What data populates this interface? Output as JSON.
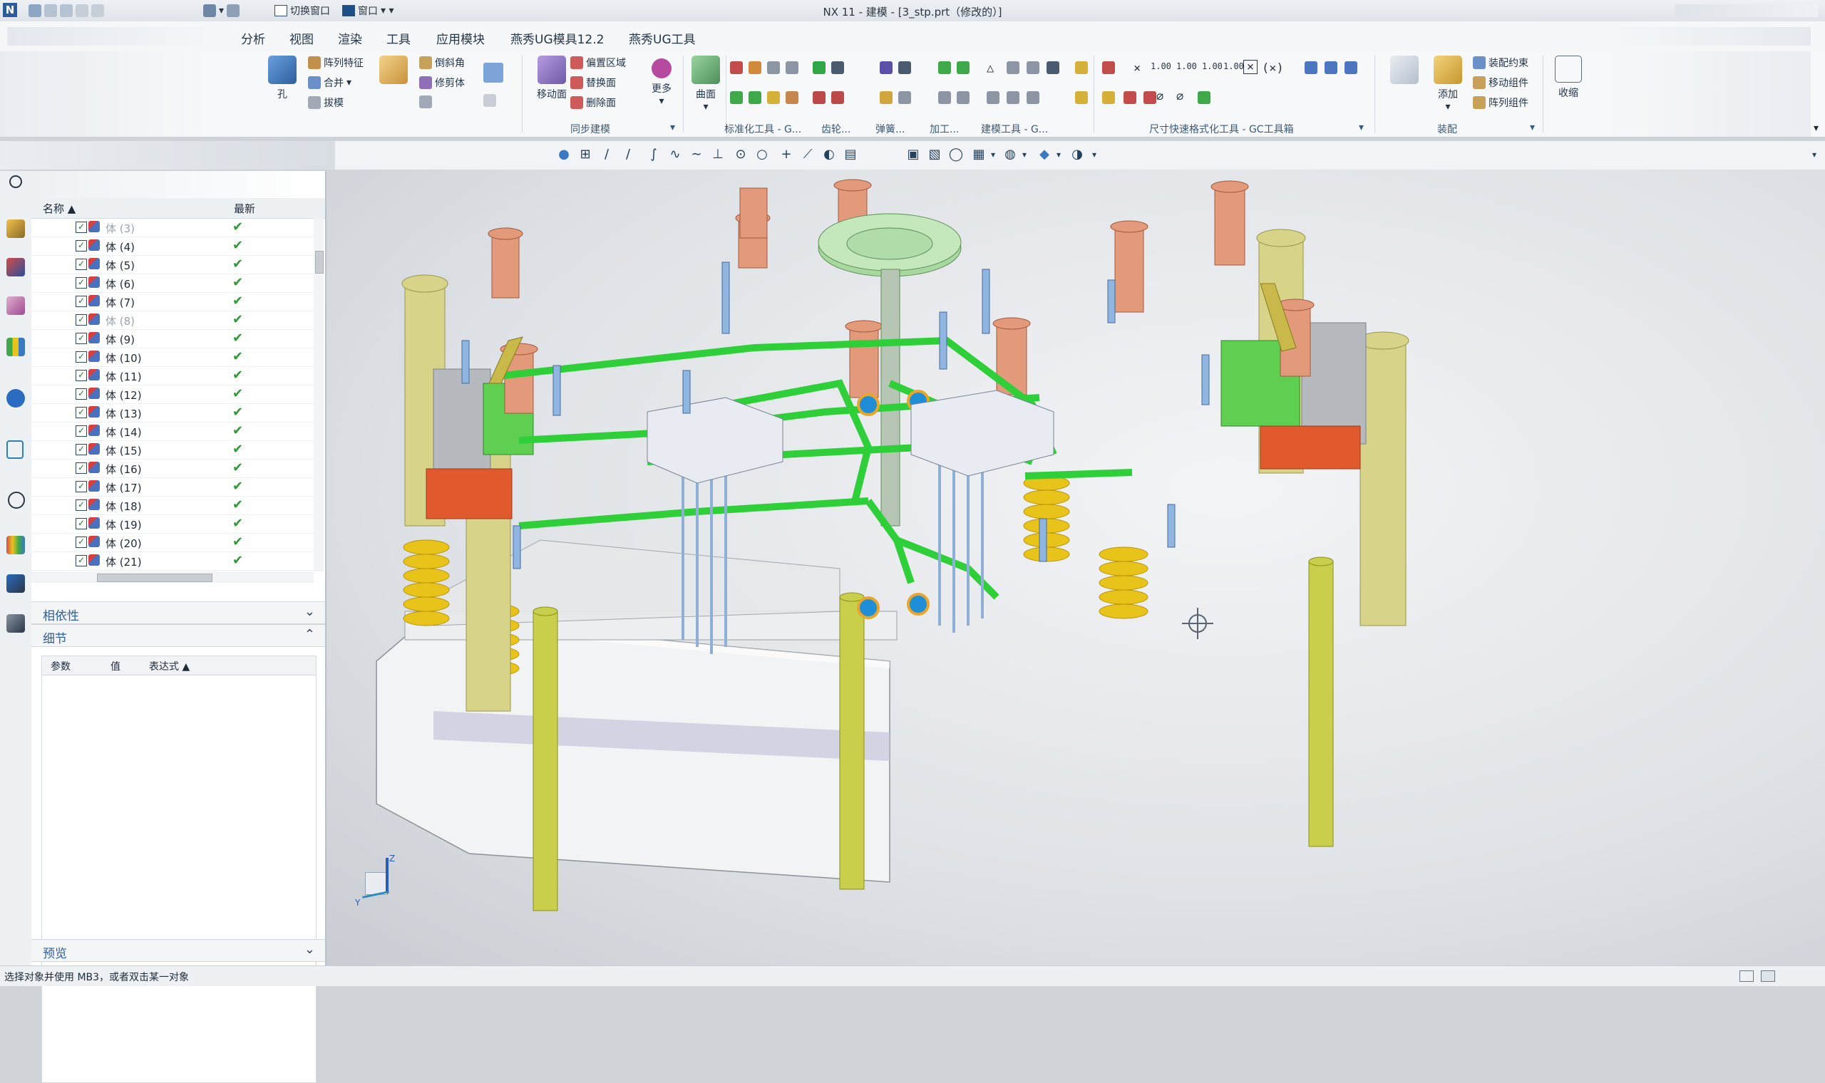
{
  "window": {
    "title": "NX 11 - 建模 - [3_stp.prt（修改的）]"
  },
  "quick_access": {
    "switch_window": "切换窗口",
    "window": "窗口"
  },
  "menu": [
    "分析",
    "视图",
    "渲染",
    "工具",
    "应用模块",
    "燕秀UG模具12.2",
    "燕秀UG工具"
  ],
  "ribbon": {
    "hole": "孔",
    "pattern_feature": "阵列特征",
    "unite": "合并",
    "draft": "拔模",
    "chamfer": "倒斜角",
    "trim_body": "修剪体",
    "move_face": "移动面",
    "offset_region": "偏置区域",
    "replace_face": "替换面",
    "delete_face": "删除面",
    "more": "更多",
    "sync_group": "同步建模",
    "surface": "曲面",
    "std_tools_group": "标准化工具 - G...",
    "gear_group": "齿轮...",
    "spring_group": "弹簧...",
    "machining_group": "加工...",
    "build_tools_group": "建模工具 - G...",
    "dim_group": "尺寸快速格式化工具 - GC工具箱",
    "assembly_constraints": "装配约束",
    "move_component": "移动组件",
    "pattern_component": "阵列组件",
    "add": "添加",
    "assembly_nav": "装配导航",
    "assembly_group": "装配",
    "shrink": "收缩"
  },
  "navigator": {
    "col_name": "名称",
    "col_latest": "最新",
    "rows": [
      {
        "label": "体 (3)",
        "dim": true
      },
      {
        "label": "体 (4)",
        "dim": false
      },
      {
        "label": "体 (5)",
        "dim": false
      },
      {
        "label": "体 (6)",
        "dim": false
      },
      {
        "label": "体 (7)",
        "dim": false
      },
      {
        "label": "体 (8)",
        "dim": true
      },
      {
        "label": "体 (9)",
        "dim": false
      },
      {
        "label": "体 (10)",
        "dim": false
      },
      {
        "label": "体 (11)",
        "dim": false
      },
      {
        "label": "体 (12)",
        "dim": false
      },
      {
        "label": "体 (13)",
        "dim": false
      },
      {
        "label": "体 (14)",
        "dim": false
      },
      {
        "label": "体 (15)",
        "dim": false
      },
      {
        "label": "体 (16)",
        "dim": false
      },
      {
        "label": "体 (17)",
        "dim": false
      },
      {
        "label": "体 (18)",
        "dim": false
      },
      {
        "label": "体 (19)",
        "dim": false
      },
      {
        "label": "体 (20)",
        "dim": false
      },
      {
        "label": "体 (21)",
        "dim": false
      }
    ],
    "dependencies": "相依性",
    "details": "细节",
    "details_cols": [
      "参数",
      "值",
      "表达式"
    ],
    "preview": "预览"
  },
  "axis": {
    "z": "Z",
    "y": "Y"
  },
  "status": {
    "text": "选择对象并使用 MB3，或者双击某一对象"
  },
  "colors": {
    "green_frame": "#2fcf3a",
    "spring": "#e8c41a",
    "pillar": "#d7d48a",
    "plate": "#eef0f2",
    "ring_blue": "#1e8fd6"
  }
}
